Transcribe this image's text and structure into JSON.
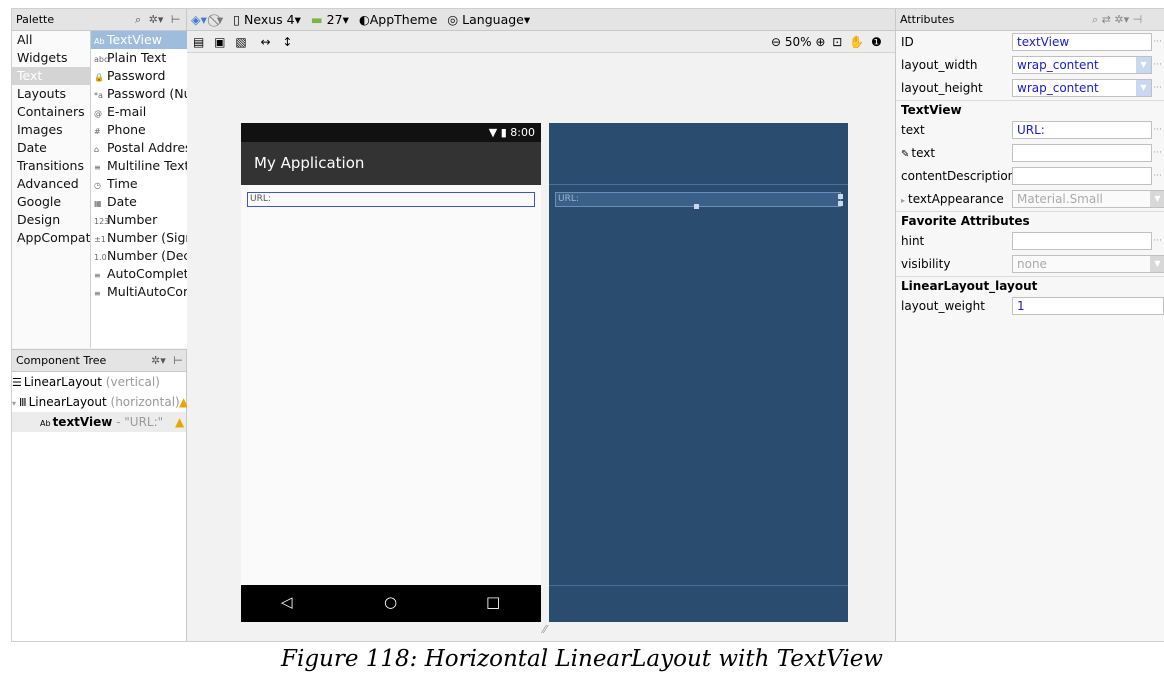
{
  "palette": {
    "title": "Palette",
    "categories": [
      "All",
      "Widgets",
      "Text",
      "Layouts",
      "Containers",
      "Images",
      "Date",
      "Transitions",
      "Advanced",
      "Google",
      "Design",
      "AppCompat"
    ],
    "selected_category": "Text",
    "components": [
      {
        "icon": "Ab",
        "label": "TextView",
        "selected": true
      },
      {
        "icon": "abc",
        "label": "Plain Text"
      },
      {
        "icon": "🔒",
        "label": "Password"
      },
      {
        "icon": "*a",
        "label": "Password (Nu"
      },
      {
        "icon": "@",
        "label": "E-mail"
      },
      {
        "icon": "#",
        "label": "Phone"
      },
      {
        "icon": "⌂",
        "label": "Postal Addres"
      },
      {
        "icon": "≡",
        "label": "Multiline Text"
      },
      {
        "icon": "◷",
        "label": "Time"
      },
      {
        "icon": "▦",
        "label": "Date"
      },
      {
        "icon": "123",
        "label": "Number"
      },
      {
        "icon": "±1",
        "label": "Number (Signe"
      },
      {
        "icon": "1.0",
        "label": "Number (Deci"
      },
      {
        "icon": "≡",
        "label": "AutoComplete"
      },
      {
        "icon": "≡",
        "label": "MultiAutoCom"
      }
    ]
  },
  "component_tree": {
    "title": "Component Tree",
    "rows": [
      {
        "icon": "☰",
        "name": "LinearLayout",
        "detail": " (vertical)",
        "warning": false
      },
      {
        "icon": "Ⅲ",
        "name": "LinearLayout",
        "detail": " (horizontal)",
        "warning": true
      },
      {
        "icon": "Ab",
        "name": "textView",
        "detail": " - \"URL:\"",
        "warning": true,
        "selected": true
      }
    ]
  },
  "toolbar": {
    "device": "Nexus 4",
    "api": "27",
    "theme": "AppTheme",
    "language": "Language",
    "zoom": "50%"
  },
  "phone": {
    "time": "8:00",
    "app_title": "My Application",
    "textview_text": "URL:"
  },
  "blueprint": {
    "textview_text": "URL:"
  },
  "attributes": {
    "title": "Attributes",
    "rows": [
      {
        "label": "ID",
        "value": "textView",
        "kind": "text"
      },
      {
        "label": "layout_width",
        "value": "wrap_content",
        "kind": "dropdown"
      },
      {
        "label": "layout_height",
        "value": "wrap_content",
        "kind": "dropdown"
      },
      {
        "label": "TextView",
        "kind": "section"
      },
      {
        "label": "text",
        "value": "URL:",
        "kind": "text"
      },
      {
        "label": "text",
        "value": "",
        "kind": "text",
        "tool_icon": true
      },
      {
        "label": "contentDescription",
        "value": "",
        "kind": "text"
      },
      {
        "label": "textAppearance",
        "value": "Material.Small",
        "kind": "dropdown-grey",
        "expander": true
      },
      {
        "label": "Favorite Attributes",
        "kind": "section"
      },
      {
        "label": "hint",
        "value": "",
        "kind": "text"
      },
      {
        "label": "visibility",
        "value": "none",
        "kind": "dropdown-grey"
      },
      {
        "label": "LinearLayout_layout",
        "kind": "section"
      },
      {
        "label": "layout_weight",
        "value": "1",
        "kind": "text-wide"
      }
    ]
  },
  "caption": "Figure 118: Horizontal LinearLayout with TextView"
}
